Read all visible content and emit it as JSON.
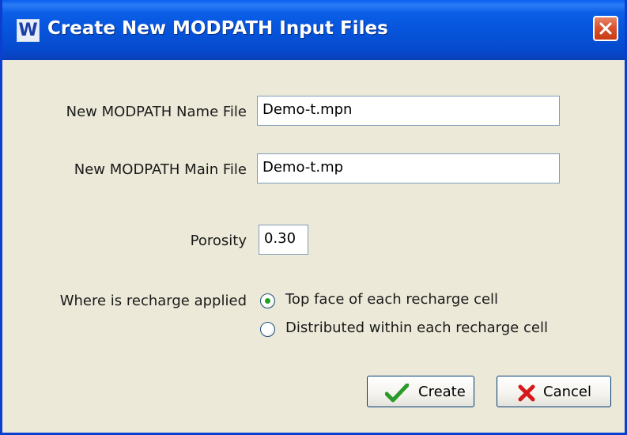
{
  "window": {
    "title": "Create New MODPATH Input Files",
    "app_icon_letter": "W",
    "accent_color": "#0a5ee6",
    "close_color": "#d9542f"
  },
  "form": {
    "name_file": {
      "label": "New MODPATH Name File",
      "value": "Demo-t.mpn"
    },
    "main_file": {
      "label": "New MODPATH Main File",
      "value": "Demo-t.mp"
    },
    "porosity": {
      "label": "Porosity",
      "value": "0.30"
    },
    "recharge": {
      "label": "Where is recharge applied",
      "selected": "top",
      "options": [
        {
          "id": "top",
          "label": "Top face of each recharge cell"
        },
        {
          "id": "distributed",
          "label": "Distributed within each recharge cell"
        }
      ]
    }
  },
  "buttons": {
    "create": {
      "label": "Create",
      "icon": "checkmark-icon",
      "icon_color": "#2a9a2a"
    },
    "cancel": {
      "label": "Cancel",
      "icon": "x-icon",
      "icon_color": "#d61818"
    }
  }
}
